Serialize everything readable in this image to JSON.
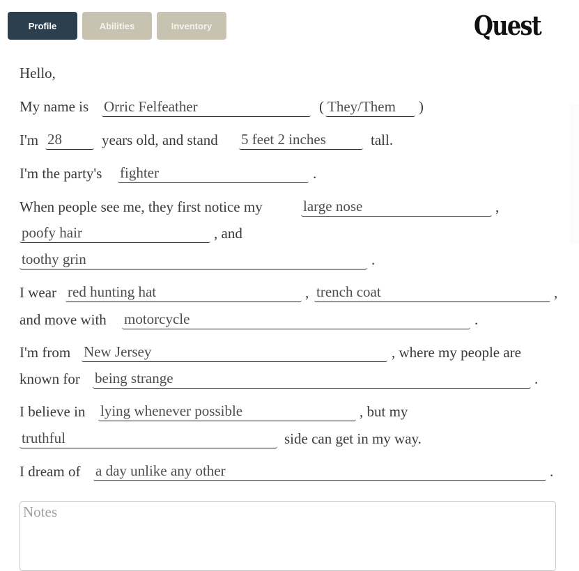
{
  "tabs": [
    {
      "label": "Profile",
      "active": true
    },
    {
      "label": "Abilities",
      "active": false
    },
    {
      "label": "Inventory",
      "active": false
    }
  ],
  "logo": "Quest",
  "form": {
    "greeting": "Hello,",
    "name_prefix": "My name is",
    "name": "Orric Felfeather",
    "paren_open": "(",
    "pronouns": "They/Them",
    "paren_close": ")",
    "age_prefix": "I'm",
    "age": "28",
    "age_suffix": "years old, and stand",
    "height": "5 feet 2 inches",
    "height_suffix": "tall.",
    "role_prefix": "I'm the party's",
    "role": "fighter",
    "role_suffix": ".",
    "notice_prefix": "When people see me, they first notice my",
    "notice_1": "large nose",
    "notice_1_suffix": ",",
    "notice_2": "poofy hair",
    "notice_2_suffix": ", and",
    "notice_3": "toothy grin",
    "notice_3_suffix": ".",
    "wear_prefix": "I wear",
    "wear_1": "red hunting hat",
    "wear_1_suffix": ",",
    "wear_2": "trench coat",
    "wear_2_suffix": ",",
    "move_prefix": "and move with",
    "move": "motorcycle",
    "move_suffix": ".",
    "from_prefix": "I'm from",
    "from": "New Jersey",
    "from_suffix": ", where my people are",
    "known_prefix": "known for",
    "known": "being strange",
    "known_suffix": ".",
    "believe_prefix": "I believe in",
    "believe": "lying whenever possible",
    "believe_suffix": ", but my",
    "side": "truthful",
    "side_suffix": "side can get in my way.",
    "dream_prefix": "I dream of",
    "dream": "a day unlike any other",
    "dream_suffix": "."
  },
  "notes": {
    "placeholder": "Notes",
    "value": ""
  }
}
